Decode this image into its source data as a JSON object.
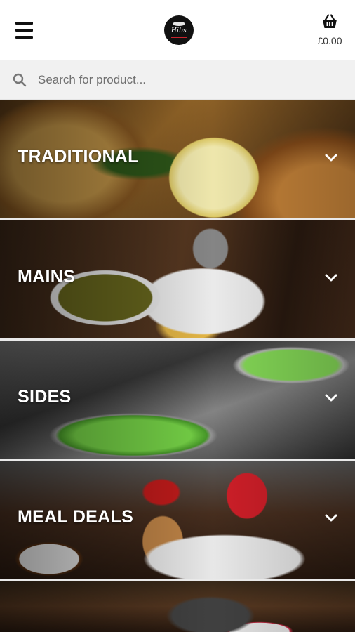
{
  "header": {
    "menu_icon": "hamburger-menu-icon",
    "logo_text": "Hibs",
    "basket_icon": "shopping-basket-icon",
    "basket_total": "£0.00"
  },
  "search": {
    "placeholder": "Search for product...",
    "value": "",
    "icon": "search-icon"
  },
  "categories": [
    {
      "label": "TRADITIONAL",
      "chevron": "chevron-down-icon"
    },
    {
      "label": "MAINS",
      "chevron": "chevron-down-icon"
    },
    {
      "label": "SIDES",
      "chevron": "chevron-down-icon"
    },
    {
      "label": "MEAL DEALS",
      "chevron": "chevron-down-icon"
    },
    {
      "label": ""
    }
  ]
}
